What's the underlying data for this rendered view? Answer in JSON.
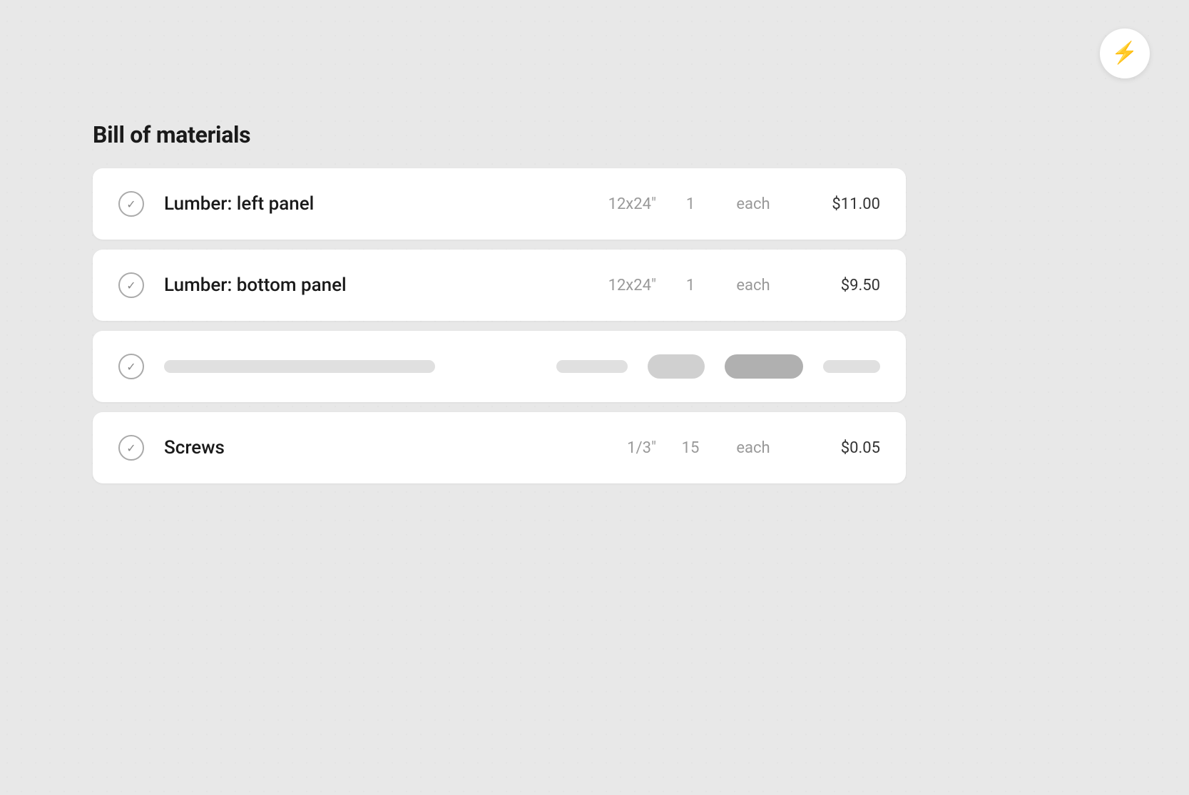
{
  "header": {
    "lightning_label": "⚡"
  },
  "page": {
    "title": "Bill of materials"
  },
  "materials": [
    {
      "id": "item-1",
      "name": "Lumber: left panel",
      "size": "12x24\"",
      "qty": "1",
      "unit": "each",
      "price": "$11.00",
      "checked": true
    },
    {
      "id": "item-2",
      "name": "Lumber: bottom panel",
      "size": "12x24\"",
      "qty": "1",
      "unit": "each",
      "price": "$9.50",
      "checked": true
    },
    {
      "id": "item-3",
      "name": null,
      "size": null,
      "qty": null,
      "unit": null,
      "price": null,
      "checked": true,
      "loading": true
    },
    {
      "id": "item-4",
      "name": "Screws",
      "size": "1/3\"",
      "qty": "15",
      "unit": "each",
      "price": "$0.05",
      "checked": true
    }
  ],
  "checkmark": "✓"
}
